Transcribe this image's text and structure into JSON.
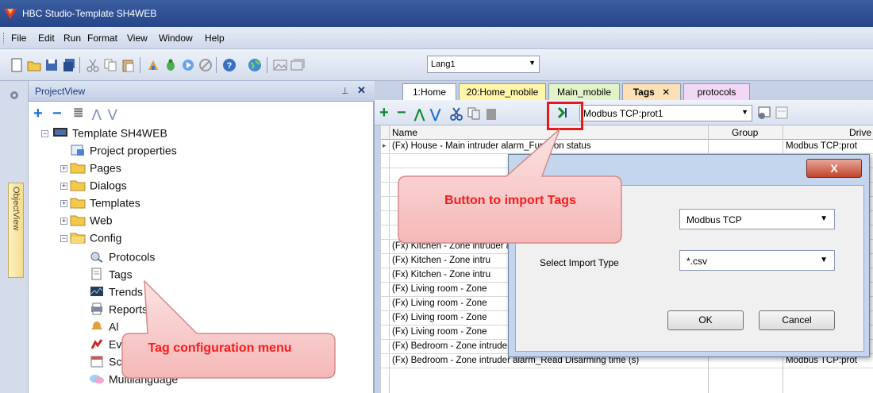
{
  "window": {
    "title": "HBC Studio-Template SH4WEB"
  },
  "menu": [
    "File",
    "Edit",
    "Run",
    "Format",
    "View",
    "Window",
    "Help"
  ],
  "toolbar": {
    "language": "Lang1"
  },
  "side_tab": {
    "label": "ObjectView"
  },
  "projectview": {
    "title": "ProjectView",
    "tree": [
      {
        "label": "Template SH4WEB",
        "icon": "monitor-icon"
      },
      {
        "label": "Project properties",
        "icon": "properties-icon"
      },
      {
        "label": "Pages",
        "icon": "folder-icon"
      },
      {
        "label": "Dialogs",
        "icon": "folder-icon"
      },
      {
        "label": "Templates",
        "icon": "folder-icon"
      },
      {
        "label": "Web",
        "icon": "folder-icon"
      },
      {
        "label": "Config",
        "icon": "folder-open-icon"
      },
      {
        "label": "Protocols",
        "icon": "protocol-icon"
      },
      {
        "label": "Tags",
        "icon": "document-icon"
      },
      {
        "label": "Trends",
        "icon": "trend-icon"
      },
      {
        "label": "Reports",
        "icon": "report-icon"
      },
      {
        "label": "Al",
        "icon": "alarm-bell-icon"
      },
      {
        "label": "Ev",
        "icon": "event-icon"
      },
      {
        "label": "Sc",
        "icon": "schedule-icon"
      },
      {
        "label": "Multilanguage",
        "icon": "multilanguage-icon"
      }
    ]
  },
  "tabs": [
    {
      "label": "1:Home",
      "color": "#ffffff"
    },
    {
      "label": "20:Home_mobile",
      "color": "#fff6a8"
    },
    {
      "label": "Main_mobile",
      "color": "#e3f3c8"
    },
    {
      "label": "Tags",
      "color": "#fde0b5",
      "active": true
    },
    {
      "label": "protocols",
      "color": "#f2d8f5"
    }
  ],
  "tags_toolbar": {
    "driver": "Modbus TCP:prot1"
  },
  "grid": {
    "columns": [
      "Name",
      "Group",
      "Drive"
    ],
    "rows": [
      {
        "name": "(Fx) House - Main intruder alarm_Function status",
        "driver": "Modbus TCP:prot"
      },
      {
        "name": "",
        "driver": ""
      },
      {
        "name": "",
        "driver": ""
      },
      {
        "name": "",
        "driver": ""
      },
      {
        "name": "",
        "driver": ""
      },
      {
        "name": "",
        "driver": ""
      },
      {
        "name": "",
        "driver": ""
      },
      {
        "name": "(Fx) Kitchen - Zone intruder alarm",
        "driver": ""
      },
      {
        "name": "(Fx) Kitchen - Zone intru",
        "driver": ""
      },
      {
        "name": "(Fx) Kitchen - Zone intru",
        "driver": ""
      },
      {
        "name": "(Fx) Living room - Zone",
        "driver": ""
      },
      {
        "name": "(Fx) Living room - Zone",
        "driver": ""
      },
      {
        "name": "(Fx) Living room - Zone",
        "driver": ""
      },
      {
        "name": "(Fx) Living room - Zone",
        "driver": ""
      },
      {
        "name": "(Fx) Bedroom - Zone intruder alarm_Function status",
        "driver": "Modbus TCP:prot"
      },
      {
        "name": "(Fx) Bedroom - Zone intruder alarm_Read Disarming time (s)",
        "driver": "Modbus TCP:prot"
      }
    ]
  },
  "dialog": {
    "close": "X",
    "driver_value": "Modbus TCP",
    "import_type_label": "Select Import Type",
    "import_type_value": "*.csv",
    "ok": "OK",
    "cancel": "Cancel"
  },
  "callouts": {
    "import": "Button to import Tags",
    "tag_config": "Tag configuration menu"
  }
}
